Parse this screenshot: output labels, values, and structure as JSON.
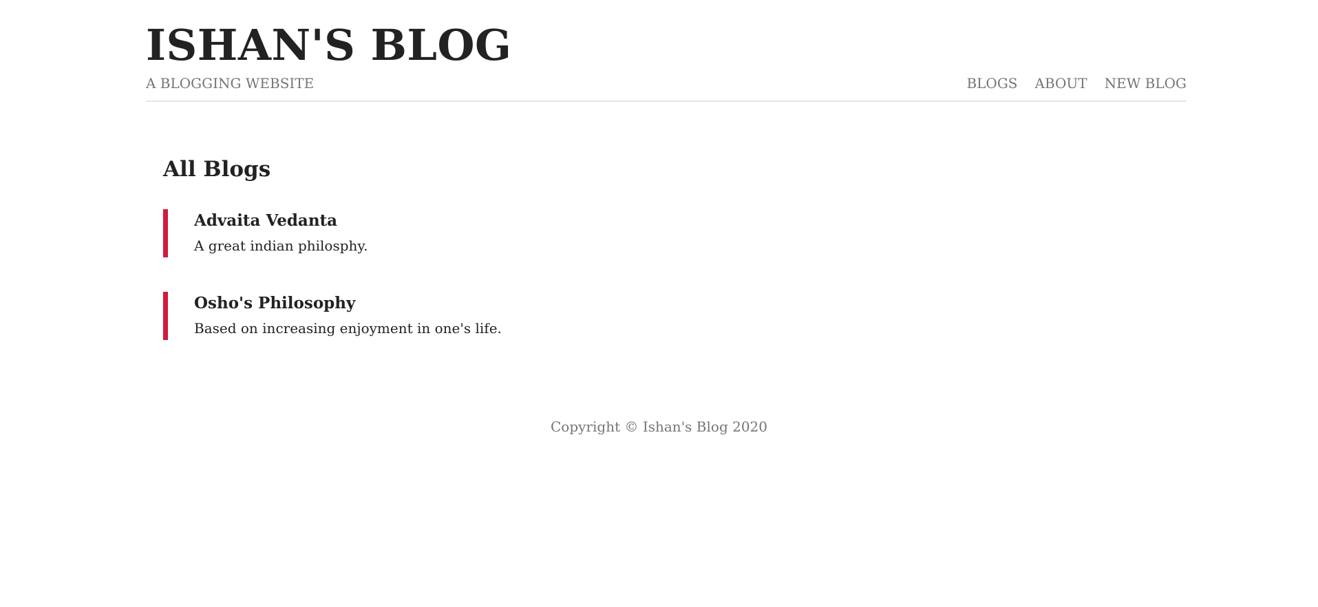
{
  "header": {
    "title": "ISHAN'S BLOG",
    "tagline": "A BLOGGING WEBSITE",
    "nav": [
      {
        "label": "BLOGS"
      },
      {
        "label": "ABOUT"
      },
      {
        "label": "NEW BLOG"
      }
    ]
  },
  "main": {
    "heading": "All Blogs",
    "blogs": [
      {
        "title": "Advaita Vedanta",
        "snippet": "A great indian philosphy."
      },
      {
        "title": "Osho's Philosophy",
        "snippet": "Based on increasing enjoyment in one's life."
      }
    ]
  },
  "footer": {
    "copyright": "Copyright © Ishan's Blog 2020"
  },
  "colors": {
    "accent": "#d21a3c",
    "muted_text": "#757575",
    "text": "#222222",
    "divider": "#e6e6e6"
  }
}
